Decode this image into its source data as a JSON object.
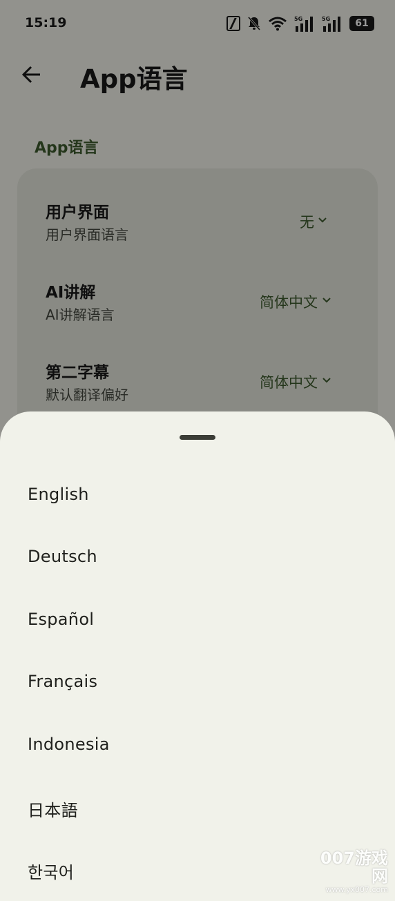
{
  "status_bar": {
    "time": "15:19",
    "battery": "61",
    "icons": [
      "nfc-icon",
      "bell-off-icon",
      "wifi-icon",
      "signal-5g-icon",
      "signal-5g-icon",
      "battery-icon"
    ],
    "signal_label_1": "5G",
    "signal_label_2": "5G"
  },
  "app_bar": {
    "title": "App语言",
    "back_icon": "arrow-left-icon"
  },
  "section": {
    "label": "App语言"
  },
  "settings": [
    {
      "title": "用户界面",
      "subtitle": "用户界面语言",
      "value": "无"
    },
    {
      "title": "AI讲解",
      "subtitle": "AI讲解语言",
      "value": "简体中文"
    },
    {
      "title": "第二字幕",
      "subtitle": "默认翻译偏好",
      "value": "简体中文"
    }
  ],
  "sheet": {
    "languages": [
      "English",
      "Deutsch",
      "Español",
      "Français",
      "Indonesia",
      "日本語",
      "한국어"
    ]
  },
  "watermark": {
    "main": "007游戏网",
    "url": "www.yx007.com"
  },
  "colors": {
    "accent": "#3d5a2d",
    "sheet_bg": "#f1f2ea",
    "card_bg": "#e4e6dc",
    "scrim": "rgba(0,0,0,0.4)"
  }
}
